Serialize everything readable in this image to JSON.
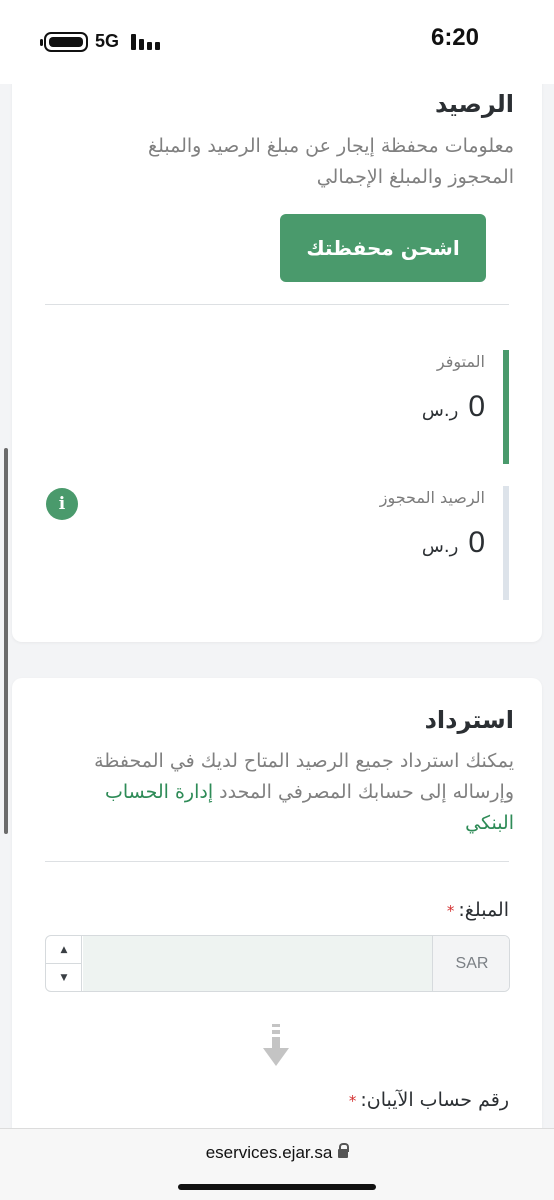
{
  "status_bar": {
    "network": "5G",
    "time": "6:20"
  },
  "balance_card": {
    "title": "الرصيد",
    "description_line1": "معلومات محفظة إيجار عن مبلغ الرصيد والمبلغ",
    "description_line2": "المحجوز والمبلغ الإجمالي",
    "topup_button": "اشحن محفظتك",
    "available": {
      "label": "المتوفر",
      "value": "0",
      "currency": "ر.س"
    },
    "reserved": {
      "label": "الرصيد المحجوز",
      "value": "0",
      "currency": "ر.س"
    },
    "info_icon": "i"
  },
  "refund_card": {
    "title": "استرداد",
    "description_line1": "يمكنك استرداد جميع الرصيد المتاح لديك في المحفظة",
    "description_line2": "وإرساله إلى حسابك المصرفي المحدد",
    "link_part1": "إدارة الحساب",
    "link_part2": "البنكي",
    "amount_label": "المبلغ:",
    "required_mark": "*",
    "amount_value": "",
    "currency_addon": "SAR",
    "step_up": "▲",
    "step_down": "▼",
    "iban_label": "رقم حساب الآيبان:"
  },
  "browser": {
    "url": "eservices.ejar.sa"
  },
  "colors": {
    "primary": "#4a9a6c",
    "reserved_bar": "#dde3ea",
    "required": "#d32f2f"
  },
  "icons": [
    "battery-icon",
    "signal-icon",
    "info-icon",
    "arrow-down-icon",
    "lock-icon"
  ]
}
